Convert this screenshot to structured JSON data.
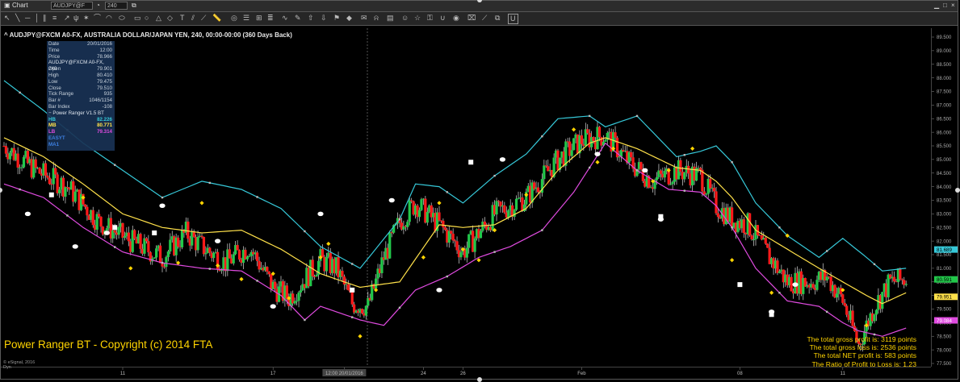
{
  "window": {
    "title": "Chart",
    "symbol_field": "AUDJPY@F",
    "interval_field": "240"
  },
  "chart_title": "^ AUDJPY@FXCM A0-FX, AUSTRALIA DOLLAR/JAPAN YEN, 240, 00:00-00:00 (360 Days Back)",
  "cursor_box": {
    "rows": [
      {
        "k": "Date",
        "v": "20/01/2016"
      },
      {
        "k": "Time",
        "v": "12:00"
      },
      {
        "k": "Price",
        "v": "78.966"
      }
    ],
    "symbol_header": "AUDJPY@FXCM A0-FX, 240",
    "ohlc": [
      {
        "k": "Open",
        "v": "79.901"
      },
      {
        "k": "High",
        "v": "80.410"
      },
      {
        "k": "Low",
        "v": "79.475"
      },
      {
        "k": "Close",
        "v": "79.510"
      },
      {
        "k": "Tick Range",
        "v": "935"
      },
      {
        "k": "Bar #",
        "v": "1046/1154"
      },
      {
        "k": "Bar Index",
        "v": "-108"
      }
    ],
    "study_header": "Power Ranger V1.5 BT",
    "study": [
      {
        "k": "HB",
        "v": "82.226",
        "color": "#36c8d8"
      },
      {
        "k": "MB",
        "v": "80.771",
        "color": "#ffe14a"
      },
      {
        "k": "LB",
        "v": "79.314",
        "color": "#e04be0"
      },
      {
        "k": "EASYT",
        "v": "",
        "color": "#3d7fe0"
      },
      {
        "k": "MA1",
        "v": "",
        "color": "#3d7fe0"
      }
    ]
  },
  "copyright": "Power Ranger BT - Copyright (c) 2014 FTA",
  "stats": [
    "The total gross profit is: 3119 points",
    "The total gross loss is: 2536 points",
    "The total NET profit is: 583 points",
    "The Ratio of Profit to Loss is: 1.23"
  ],
  "footer": {
    "brand": "© eSignal, 2016",
    "mode": "Dyn"
  },
  "chart_data": {
    "type": "candlestick",
    "symbol": "AUDJPY@FXCM",
    "interval": "240",
    "ylim": [
      77.5,
      89.6
    ],
    "y_ticks": [
      "89.500",
      "89.000",
      "88.500",
      "88.000",
      "87.500",
      "87.000",
      "86.500",
      "86.000",
      "85.500",
      "85.000",
      "84.500",
      "84.000",
      "83.500",
      "83.000",
      "82.500",
      "82.000",
      "81.500",
      "81.000",
      "80.500",
      "80.000",
      "79.500",
      "79.000",
      "78.500",
      "78.000",
      "77.500"
    ],
    "x_labels": [
      {
        "text": "11",
        "bar": 15
      },
      {
        "text": "17",
        "bar": 34
      },
      {
        "text": "12:00 20/01/2016",
        "bar": 43
      },
      {
        "text": "24",
        "bar": 53
      },
      {
        "text": "26",
        "bar": 58
      },
      {
        "text": "Feb",
        "bar": 73
      },
      {
        "text": "08",
        "bar": 93
      },
      {
        "text": "11",
        "bar": 106
      }
    ],
    "last_values": [
      {
        "label": "81.689",
        "value": 81.689,
        "color": "#36c8d8"
      },
      {
        "label": "80.591",
        "value": 80.591,
        "color": "#22c84a"
      },
      {
        "label": "79.951",
        "value": 79.951,
        "color": "#ffe14a"
      },
      {
        "label": "79.084",
        "value": 79.084,
        "color": "#e04be0"
      },
      {
        "label": "76.966",
        "value": 76.966,
        "color": "#3a3a3a"
      }
    ],
    "series": [
      {
        "name": "HB",
        "color": "#36c8d8",
        "anchors": [
          [
            0,
            87.9
          ],
          [
            5,
            86.8
          ],
          [
            10,
            85.6
          ],
          [
            15,
            84.6
          ],
          [
            20,
            83.6
          ],
          [
            25,
            84.2
          ],
          [
            30,
            83.9
          ],
          [
            35,
            83.2
          ],
          [
            40,
            81.8
          ],
          [
            45,
            81.0
          ],
          [
            50,
            82.8
          ],
          [
            52,
            84.1
          ],
          [
            55,
            84.0
          ],
          [
            58,
            83.4
          ],
          [
            62,
            84.4
          ],
          [
            66,
            85.2
          ],
          [
            70,
            86.5
          ],
          [
            74,
            86.6
          ],
          [
            76,
            86.2
          ],
          [
            80,
            86.6
          ],
          [
            85,
            85.1
          ],
          [
            88,
            85.3
          ],
          [
            90,
            85.5
          ],
          [
            92,
            84.9
          ],
          [
            95,
            83.4
          ],
          [
            99,
            82.2
          ],
          [
            103,
            81.4
          ],
          [
            106,
            82.1
          ],
          [
            109,
            81.4
          ],
          [
            111,
            80.9
          ],
          [
            114,
            81.0
          ]
        ]
      },
      {
        "name": "MB",
        "color": "#ffe14a",
        "anchors": [
          [
            0,
            85.8
          ],
          [
            5,
            85.1
          ],
          [
            10,
            84.1
          ],
          [
            15,
            83.0
          ],
          [
            20,
            82.5
          ],
          [
            25,
            82.3
          ],
          [
            30,
            82.4
          ],
          [
            35,
            81.7
          ],
          [
            40,
            80.8
          ],
          [
            45,
            80.3
          ],
          [
            50,
            80.5
          ],
          [
            55,
            82.6
          ],
          [
            58,
            82.5
          ],
          [
            62,
            82.6
          ],
          [
            66,
            83.2
          ],
          [
            70,
            84.6
          ],
          [
            74,
            85.6
          ],
          [
            76,
            85.8
          ],
          [
            80,
            85.4
          ],
          [
            85,
            84.7
          ],
          [
            88,
            84.6
          ],
          [
            90,
            84.2
          ],
          [
            92,
            83.6
          ],
          [
            95,
            82.4
          ],
          [
            99,
            81.7
          ],
          [
            103,
            81.0
          ],
          [
            106,
            80.5
          ],
          [
            109,
            80.0
          ],
          [
            111,
            79.7
          ],
          [
            114,
            80.1
          ]
        ]
      },
      {
        "name": "LB",
        "color": "#e04be0",
        "anchors": [
          [
            0,
            84.1
          ],
          [
            5,
            83.6
          ],
          [
            10,
            82.5
          ],
          [
            15,
            81.6
          ],
          [
            20,
            81.2
          ],
          [
            25,
            81.0
          ],
          [
            30,
            80.9
          ],
          [
            35,
            80.0
          ],
          [
            38,
            79.1
          ],
          [
            40,
            79.6
          ],
          [
            45,
            79.1
          ],
          [
            48,
            78.9
          ],
          [
            52,
            80.2
          ],
          [
            56,
            80.7
          ],
          [
            60,
            81.4
          ],
          [
            64,
            81.8
          ],
          [
            68,
            82.4
          ],
          [
            72,
            83.8
          ],
          [
            76,
            85.6
          ],
          [
            80,
            84.6
          ],
          [
            84,
            83.9
          ],
          [
            88,
            83.8
          ],
          [
            90,
            83.3
          ],
          [
            92,
            82.5
          ],
          [
            95,
            81.0
          ],
          [
            99,
            79.8
          ],
          [
            103,
            79.6
          ],
          [
            106,
            79.0
          ],
          [
            108,
            78.7
          ],
          [
            111,
            78.5
          ],
          [
            114,
            78.8
          ]
        ]
      },
      {
        "name": "Close",
        "color": "#22c84a",
        "anchors": [
          [
            0,
            85.5
          ],
          [
            4,
            84.6
          ],
          [
            8,
            84.0
          ],
          [
            12,
            82.7
          ],
          [
            16,
            82.0
          ],
          [
            20,
            81.4
          ],
          [
            23,
            82.3
          ],
          [
            25,
            81.8
          ],
          [
            28,
            81.2
          ],
          [
            31,
            81.8
          ],
          [
            34,
            80.3
          ],
          [
            36,
            79.9
          ],
          [
            38,
            80.6
          ],
          [
            40,
            81.3
          ],
          [
            42,
            81.0
          ],
          [
            44,
            79.7
          ],
          [
            46,
            79.6
          ],
          [
            48,
            81.4
          ],
          [
            50,
            82.7
          ],
          [
            52,
            83.4
          ],
          [
            55,
            82.6
          ],
          [
            58,
            81.6
          ],
          [
            62,
            83.0
          ],
          [
            66,
            83.6
          ],
          [
            70,
            85.0
          ],
          [
            73,
            85.7
          ],
          [
            76,
            85.9
          ],
          [
            79,
            84.9
          ],
          [
            82,
            84.2
          ],
          [
            85,
            84.6
          ],
          [
            88,
            84.4
          ],
          [
            90,
            83.3
          ],
          [
            92,
            82.8
          ],
          [
            94,
            82.6
          ],
          [
            96,
            81.7
          ],
          [
            99,
            80.5
          ],
          [
            102,
            80.5
          ],
          [
            104,
            80.7
          ],
          [
            106,
            79.8
          ],
          [
            108,
            78.2
          ],
          [
            110,
            79.6
          ],
          [
            112,
            80.5
          ],
          [
            114,
            80.6
          ]
        ]
      },
      {
        "name": "BuySignals",
        "color": "#ffd400",
        "points": [
          [
            10,
            83.6
          ],
          [
            16,
            81.0
          ],
          [
            22,
            81.2
          ],
          [
            25,
            83.4
          ],
          [
            27,
            81.1
          ],
          [
            30,
            80.6
          ],
          [
            34,
            80.8
          ],
          [
            36,
            79.9
          ],
          [
            40,
            81.4
          ],
          [
            41,
            81.9
          ],
          [
            45,
            78.5
          ],
          [
            47,
            80.2
          ],
          [
            53,
            81.4
          ],
          [
            55,
            83.4
          ],
          [
            58,
            81.7
          ],
          [
            60,
            81.3
          ],
          [
            62,
            82.4
          ],
          [
            66,
            83.7
          ],
          [
            72,
            86.1
          ],
          [
            75,
            84.9
          ],
          [
            77,
            85.4
          ],
          [
            82,
            84.2
          ],
          [
            84,
            84.6
          ],
          [
            87,
            85.4
          ],
          [
            92,
            81.3
          ],
          [
            97,
            80.1
          ],
          [
            99,
            82.2
          ],
          [
            106,
            80.2
          ],
          [
            109,
            78.9
          ]
        ]
      },
      {
        "name": "ExitWhite",
        "color": "#ffffff",
        "points": [
          [
            3,
            83.0
          ],
          [
            9,
            81.8
          ],
          [
            13,
            82.3
          ],
          [
            20,
            83.3
          ],
          [
            27,
            82.0
          ],
          [
            34,
            79.6
          ],
          [
            40,
            83.0
          ],
          [
            49,
            83.5
          ],
          [
            55,
            80.2
          ],
          [
            63,
            85.0
          ],
          [
            75,
            85.2
          ],
          [
            81,
            84.6
          ],
          [
            83,
            82.8
          ],
          [
            97,
            79.4
          ],
          [
            100,
            80.4
          ]
        ]
      },
      {
        "name": "ExitSquares",
        "color": "#ffffff",
        "points": [
          [
            6,
            83.7
          ],
          [
            14,
            82.5
          ],
          [
            19,
            82.3
          ],
          [
            44,
            80.2
          ],
          [
            59,
            84.9
          ],
          [
            83,
            82.9
          ],
          [
            93,
            80.4
          ],
          [
            97,
            79.3
          ]
        ]
      }
    ]
  }
}
